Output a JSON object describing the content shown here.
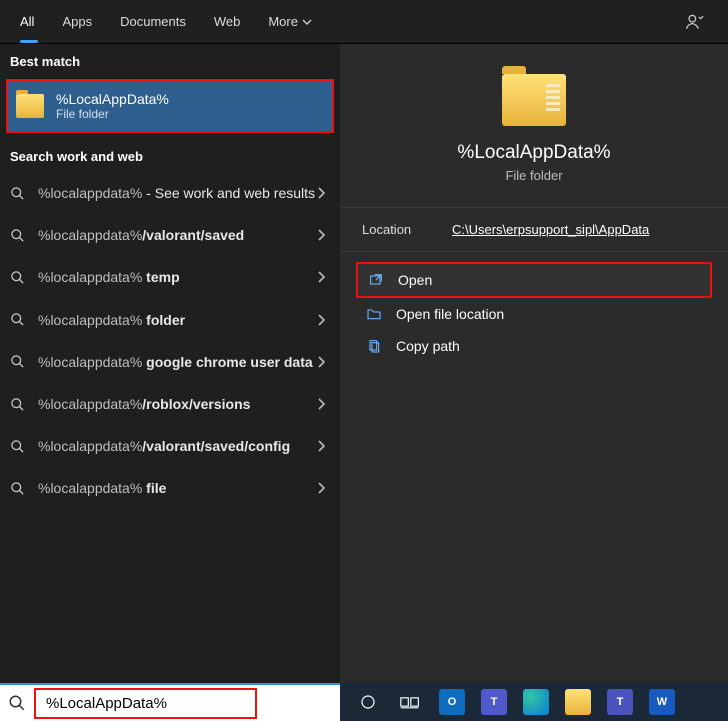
{
  "header": {
    "tabs": {
      "all": "All",
      "apps": "Apps",
      "documents": "Documents",
      "web": "Web",
      "more": "More"
    }
  },
  "left": {
    "best_match_label": "Best match",
    "best_match": {
      "title": "%LocalAppData%",
      "subtitle": "File folder"
    },
    "search_section_label": "Search work and web",
    "items": [
      {
        "query": "%localappdata%",
        "suffix": " - See work and web results"
      },
      {
        "query": "%localappdata%",
        "suffix": "/valorant/saved"
      },
      {
        "query": "%localappdata%",
        "suffix": " temp"
      },
      {
        "query": "%localappdata%",
        "suffix": " folder"
      },
      {
        "query": "%localappdata%",
        "suffix": " google chrome user data"
      },
      {
        "query": "%localappdata%",
        "suffix": "/roblox/versions"
      },
      {
        "query": "%localappdata%",
        "suffix": "/valorant/saved/config"
      },
      {
        "query": "%localappdata%",
        "suffix": " file"
      }
    ]
  },
  "right": {
    "title": "%LocalAppData%",
    "subtitle": "File folder",
    "location_label": "Location",
    "location_path": "C:\\Users\\erpsupport_sipl\\AppData",
    "actions": {
      "open": "Open",
      "open_loc": "Open file location",
      "copy": "Copy path"
    }
  },
  "taskbar": {
    "search_value": "%LocalAppData%"
  }
}
